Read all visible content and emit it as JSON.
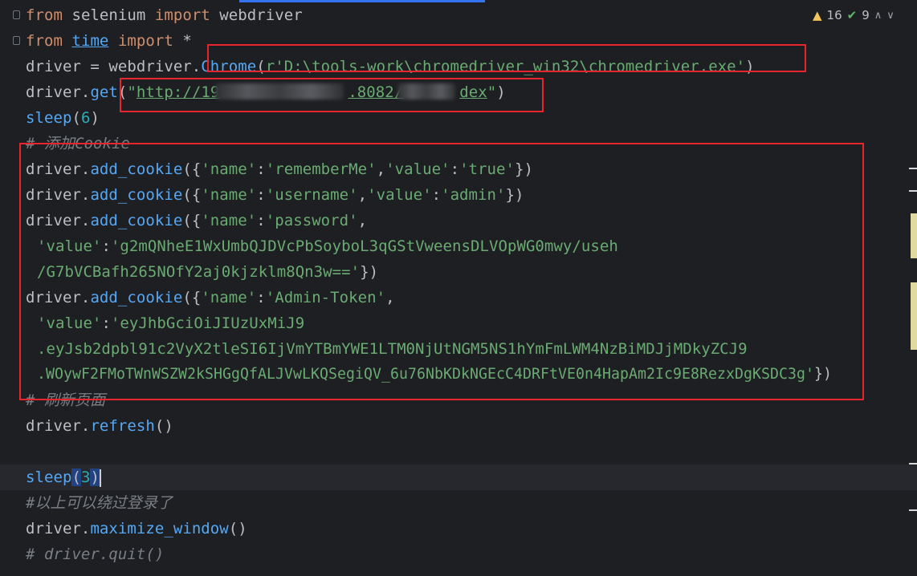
{
  "inspection": {
    "warnings_count": "16",
    "checks_count": "9",
    "warn_symbol": "▲",
    "check_symbol": "✔",
    "up_symbol": "∧",
    "down_symbol": "∨"
  },
  "code": {
    "l1_kw1": "from",
    "l1_mod": " selenium ",
    "l1_kw2": "import",
    "l1_name": " webdriver",
    "l2_kw1": "from",
    "l2_mod": "time",
    "l2_kw2": "import",
    "l2_star": " *",
    "l3_pre": "driver = webdriver.",
    "l3_fn": "Chrome",
    "l3_open": "(",
    "l3_str": "r'D:\\tools-work\\chromedriver_win32\\chromedriver.exe'",
    "l3_close": ")",
    "l4_pre": "driver.",
    "l4_fn": "get",
    "l4_open": "(",
    "l4_q1": "\"",
    "l4_url_a": "http://19",
    "l4_url_b": ".8082/",
    "l4_url_c": "dex",
    "l4_q2": "\"",
    "l4_close": ")",
    "l5_fn": "sleep",
    "l5_open": "(",
    "l5_num": "6",
    "l5_close": ")",
    "l6_com": "# 添加Cookie",
    "l7_pre": "driver.",
    "l7_fn": "add_cookie",
    "l7_a": "({",
    "l7_s1": "'name'",
    "l7_c1": ":",
    "l7_s2": "'rememberMe'",
    "l7_c2": ",",
    "l7_s3": "'value'",
    "l7_c3": ":",
    "l7_s4": "'true'",
    "l7_z": "})",
    "l8_pre": "driver.",
    "l8_fn": "add_cookie",
    "l8_a": "({",
    "l8_s1": "'name'",
    "l8_c1": ":",
    "l8_s2": "'username'",
    "l8_c2": ",",
    "l8_s3": "'value'",
    "l8_c3": ":",
    "l8_s4": "'admin'",
    "l8_z": "})",
    "l9_pre": "driver.",
    "l9_fn": "add_cookie",
    "l9_a": "({",
    "l9_s1": "'name'",
    "l9_c1": ":",
    "l9_s2": "'password'",
    "l9_c2": ",",
    "l10_s1": "'value'",
    "l10_c1": ":",
    "l10_s2": "'g2mQNheE1WxUmbQJDVcPbSoyboL3qGStVweensDLVOpWG0mwy/useh",
    "l11_s": "/G7bVCBafh265NOfY2aj0kjzklm8Qn3w=='",
    "l11_z": "})",
    "l12_pre": "driver.",
    "l12_fn": "add_cookie",
    "l12_a": "({",
    "l12_s1": "'name'",
    "l12_c1": ":",
    "l12_s2": "'Admin-Token'",
    "l12_c2": ",",
    "l13_s1": "'value'",
    "l13_c1": ":",
    "l13_s2": "'eyJhbGciOiJIUzUxMiJ9",
    "l14_s": ".eyJsb2dpbl91c2VyX2tleSI6IjVmYTBmYWE1LTM0NjUtNGM5NS1hYmFmLWM4NzBiMDJjMDkyZCJ9",
    "l15_s": ".WOywF2FMoTWnWSZW2kSHGgQfALJVwLKQSegiQV_6u76NbKDkNGEcC4DRFtVE0n4HapAm2Ic9E8RezxDgKSDC3g'",
    "l15_z": "})",
    "l16_com": "# 刷新页面",
    "l17_pre": "driver.",
    "l17_fn": "refresh",
    "l17_z": "()",
    "l19_fn": "sleep",
    "l19_open": "(",
    "l19_num": "3",
    "l19_close": ")",
    "l20_com": "#以上可以绕过登录了",
    "l21_pre": "driver.",
    "l21_fn": "maximize_window",
    "l21_z": "()",
    "l22_com": "# driver.quit()"
  }
}
